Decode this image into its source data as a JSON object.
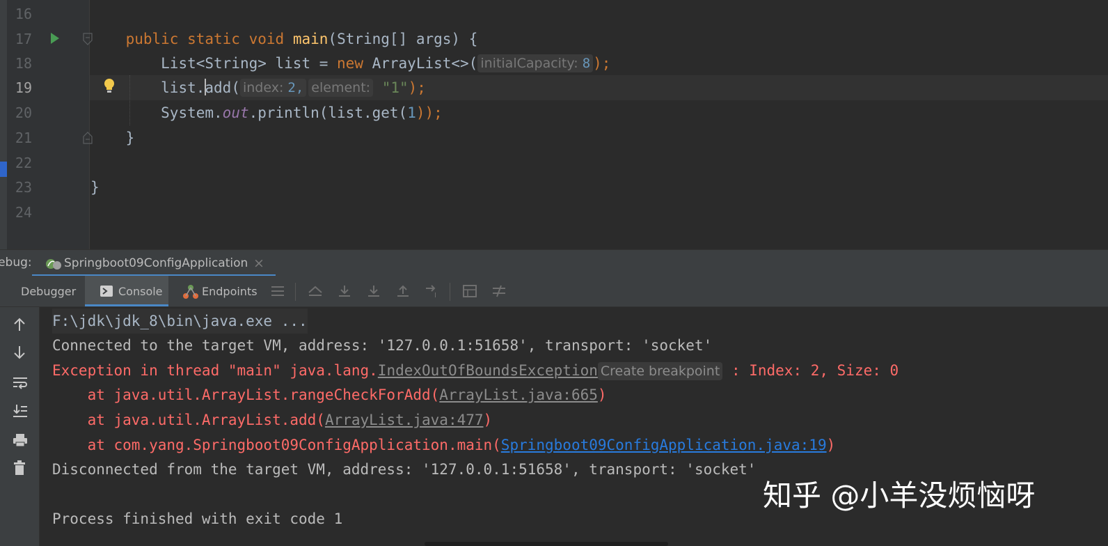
{
  "editor": {
    "line_numbers": [
      "16",
      "17",
      "18",
      "19",
      "20",
      "21",
      "22",
      "23",
      "24"
    ],
    "current_line": "19",
    "code": {
      "l17": {
        "kw1": "public",
        "kw2": "static",
        "kw3": "void",
        "method": "main",
        "rest": "(String[] args) {"
      },
      "l18": {
        "a": "List<String> list = ",
        "kw_new": "new",
        "b": " ArrayList<>(",
        "hint_label": "initialCapacity:",
        "hint_value": "8",
        "c": ");"
      },
      "l19": {
        "a": "list.",
        "b": "add",
        "c": "(",
        "hint1_label": "index:",
        "hint1_value": "2,",
        "hint2_label": "element:",
        "str": "\"1\"",
        "d": ");"
      },
      "l20": {
        "a": "System.",
        "field": "out",
        "b": ".println(list.get(",
        "num": "1",
        "c": "));"
      },
      "l21": "}",
      "l23": "}"
    }
  },
  "debug": {
    "label": "Debug:",
    "run_config": "Springboot09ConfigApplication",
    "tabs": {
      "debugger": "Debugger",
      "console": "Console",
      "endpoints": "Endpoints"
    }
  },
  "console": {
    "cmd": "F:\\jdk\\jdk_8\\bin\\java.exe ...",
    "connected": "Connected to the target VM, address: '127.0.0.1:51658', transport: 'socket'",
    "exc": {
      "prefix": "Exception in thread \"main\" java.lang.",
      "cls": "IndexOutOfBoundsException",
      "bp_hint": "Create breakpoint",
      "suffix": " : Index: 2, Size: 0"
    },
    "trace": [
      {
        "prefix": "    at java.util.ArrayList.rangeCheckForAdd(",
        "link": "ArrayList.java:665",
        "suffix": ")"
      },
      {
        "prefix": "    at java.util.ArrayList.add(",
        "link": "ArrayList.java:477",
        "suffix": ")"
      },
      {
        "prefix": "    at com.yang.Springboot09ConfigApplication.main(",
        "link": "Springboot09ConfigApplication.java:19",
        "suffix": ")"
      }
    ],
    "disconnected": "Disconnected from the target VM, address: '127.0.0.1:51658', transport: 'socket'",
    "finished": "Process finished with exit code 1"
  },
  "watermark": "知乎 @小羊没烦恼呀",
  "colors": {
    "keyword": "#cc7832",
    "method": "#ffc66d",
    "number": "#6897bb",
    "string": "#6a8759",
    "error": "#ff6b68",
    "link": "#287bde",
    "background": "#2b2b2b",
    "accent": "#4a88c7"
  },
  "icons": [
    "run-icon",
    "fold-icon",
    "bulb-icon",
    "spring-icon",
    "console-icon",
    "endpoints-icon",
    "up-arrow-icon",
    "down-arrow-icon",
    "soft-wrap-icon",
    "scroll-end-icon",
    "print-icon",
    "trash-icon"
  ]
}
